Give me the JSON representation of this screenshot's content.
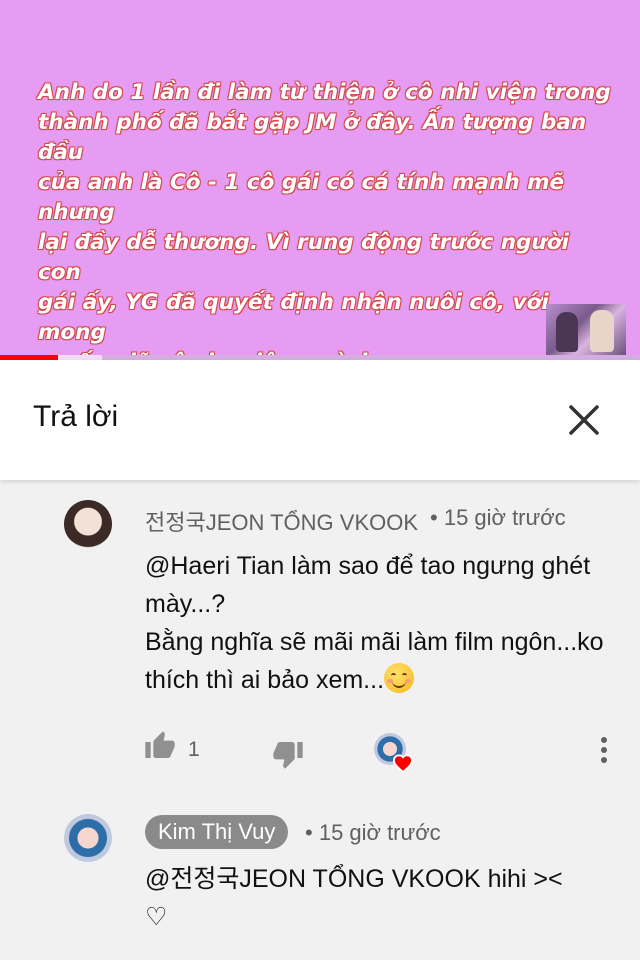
{
  "video": {
    "caption": "Anh do 1 lần đi làm từ thiện ở cô nhi viện trong\nthành phố đã bắt gặp JM ở đây. Ấn tượng ban đầu\ncủa anh là Cô - 1 cô gái có cá tính mạnh mẽ nhưng\nlại đầy dễ thương. Vì rung động trước người con\ngái ấy, YG đã quyết định nhận nuôi cô, với mong\nmuốn giữ cô cho riêng mình ><.",
    "progress_fraction": 0.09,
    "buffer_fraction": 0.16
  },
  "colors": {
    "video_bg": "#e79cf3",
    "progress": "#ff0000",
    "caption_outline": "#d44a4a",
    "heart": "#ff0000"
  },
  "reply_panel": {
    "title": "Trả lời",
    "close_icon": "close-icon"
  },
  "comments": [
    {
      "author": "전정국JEON TỔNG VKOOK",
      "time": "15 giờ trước",
      "line1": "@Haeri Tian làm sao để tao ngưng ghét mày...?",
      "line2": "Bằng nghĩa sẽ mãi mãi làm film ngôn...ko thích thì ai bảo xem...",
      "emoji": "smiling-face-emoji",
      "likes": "1",
      "icons": [
        "thumbs-up-icon",
        "thumbs-down-icon",
        "creator-heart-icon",
        "more-vertical-icon"
      ]
    },
    {
      "author": "Kim Thị Vuy",
      "time": "15 giờ trước",
      "text": "@전정국JEON TỔNG VKOOK hihi ><\n♡"
    }
  ]
}
